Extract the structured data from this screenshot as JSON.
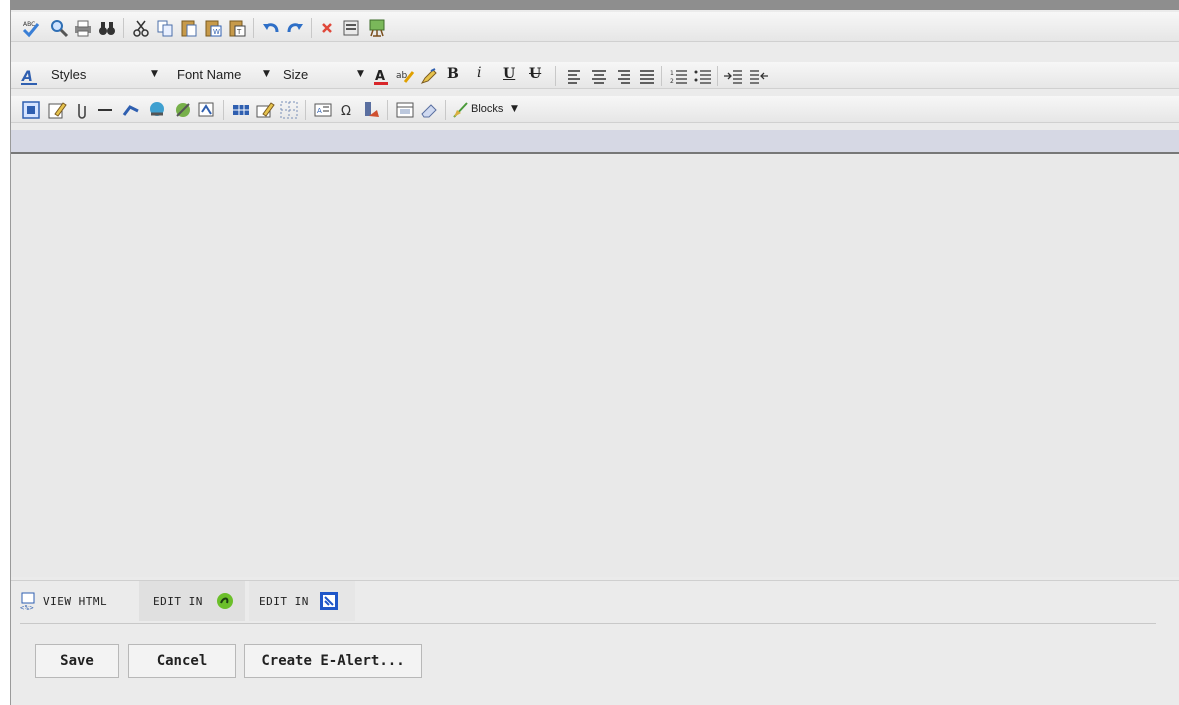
{
  "toolbar_rows": {
    "row1_icons": [
      "spellcheck-icon",
      "find-icon",
      "print-icon",
      "binoculars-icon",
      "cut-icon",
      "copy-icon",
      "paste-icon",
      "paste-word-icon",
      "paste-text-icon",
      "undo-icon",
      "redo-icon",
      "delete-icon",
      "preview-icon",
      "template-icon"
    ],
    "row2": {
      "styles_label": "Styles",
      "font_name_label": "Font Name",
      "size_label": "Size",
      "bold_label": "B",
      "italic_label": "i",
      "underline_label": "U",
      "strike_label": "U"
    },
    "row3": {
      "blocks_label": "Blocks"
    }
  },
  "bottom_tabs": {
    "view_html": "VIEW HTML",
    "edit_in_1": "EDIT IN",
    "edit_in_2": "EDIT IN"
  },
  "buttons": {
    "save": "Save",
    "cancel": "Cancel",
    "create_alert": "Create E-Alert..."
  },
  "colors": {
    "accent_band": "#d6d8e4",
    "editor_bg": "#e9e9e9"
  }
}
